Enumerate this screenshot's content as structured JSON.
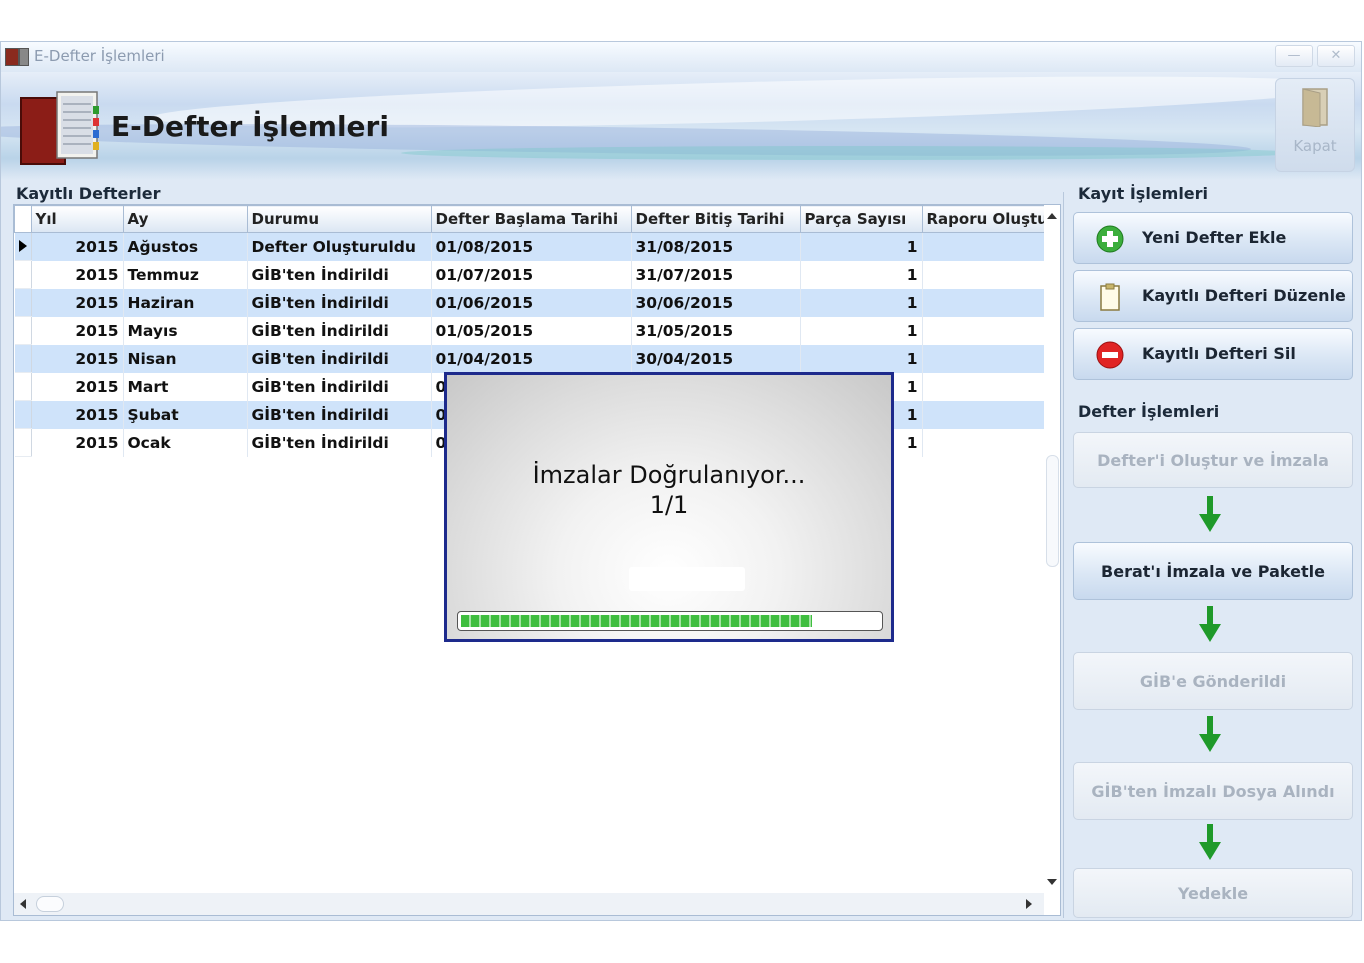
{
  "window": {
    "title": "E-Defter İşlemleri",
    "minimize": "—",
    "close": "✕"
  },
  "banner": {
    "title": "E-Defter İşlemleri",
    "close_label": "Kapat"
  },
  "left": {
    "group_title": "Kayıtlı Defterler",
    "columns": [
      "Yıl",
      "Ay",
      "Durumu",
      "Defter Başlama Tarihi",
      "Defter Bitiş Tarihi",
      "Parça Sayısı",
      "Raporu Oluştu"
    ],
    "rows": [
      {
        "year": "2015",
        "month": "Ağustos",
        "status": "Defter Oluşturuldu",
        "start": "01/08/2015",
        "end": "31/08/2015",
        "parts": "1"
      },
      {
        "year": "2015",
        "month": "Temmuz",
        "status": "GİB'ten İndirildi",
        "start": "01/07/2015",
        "end": "31/07/2015",
        "parts": "1"
      },
      {
        "year": "2015",
        "month": "Haziran",
        "status": "GİB'ten İndirildi",
        "start": "01/06/2015",
        "end": "30/06/2015",
        "parts": "1"
      },
      {
        "year": "2015",
        "month": "Mayıs",
        "status": "GİB'ten İndirildi",
        "start": "01/05/2015",
        "end": "31/05/2015",
        "parts": "1"
      },
      {
        "year": "2015",
        "month": "Nisan",
        "status": "GİB'ten İndirildi",
        "start": "01/04/2015",
        "end": "30/04/2015",
        "parts": "1"
      },
      {
        "year": "2015",
        "month": "Mart",
        "status": "GİB'ten İndirildi",
        "start": "0",
        "end": "",
        "parts": "1"
      },
      {
        "year": "2015",
        "month": "Şubat",
        "status": "GİB'ten İndirildi",
        "start": "0",
        "end": "",
        "parts": "1"
      },
      {
        "year": "2015",
        "month": "Ocak",
        "status": "GİB'ten İndirildi",
        "start": "0",
        "end": "",
        "parts": "1"
      }
    ]
  },
  "right": {
    "record_group": "Kayıt İşlemleri",
    "new_book": "Yeni Defter Ekle",
    "edit_book": "Kayıtlı Defteri Düzenle",
    "delete_book": "Kayıtlı Defteri Sil",
    "book_group": "Defter İşlemleri",
    "create_sign": "Defter'i Oluştur ve İmzala",
    "sign_package": "Berat'ı İmzala ve Paketle",
    "sent_gib": "GİB'e Gönderildi",
    "signed_received": "GİB'ten İmzalı Dosya Alındı",
    "backup": "Yedekle"
  },
  "dialog": {
    "message": "İmzalar Doğrulanıyor...",
    "counter": "1/1",
    "progress": 0.84
  },
  "colors": {
    "dialog_border": "#1d2a8c",
    "row_alt": "#cfe3fa",
    "progress_green": "#3fbe3f",
    "arrow_green": "#1f9a2a"
  }
}
